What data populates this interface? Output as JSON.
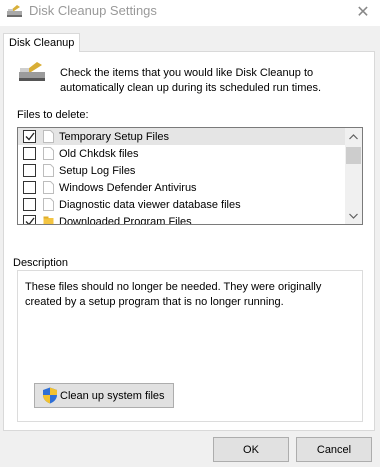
{
  "window": {
    "title": "Disk Cleanup Settings",
    "close_glyph": "✕",
    "title_icon": "disk-cleanup-icon"
  },
  "tab": {
    "label": "Disk Cleanup"
  },
  "intro": {
    "icon": "disk-cleanup-large-icon",
    "text": "Check the items that you would like Disk Cleanup to automatically clean up during its scheduled run times."
  },
  "files": {
    "label": "Files to delete:",
    "items": [
      {
        "label": "Temporary Setup Files",
        "checked": true,
        "icon": "file-icon",
        "selected": true
      },
      {
        "label": "Old Chkdsk files",
        "checked": false,
        "icon": "file-icon",
        "selected": false
      },
      {
        "label": "Setup Log Files",
        "checked": false,
        "icon": "file-icon",
        "selected": false
      },
      {
        "label": "Windows Defender Antivirus",
        "checked": false,
        "icon": "file-icon",
        "selected": false
      },
      {
        "label": "Diagnostic data viewer database files",
        "checked": false,
        "icon": "file-icon",
        "selected": false
      },
      {
        "label": "Downloaded Program Files",
        "checked": true,
        "icon": "folder-icon",
        "selected": false
      }
    ]
  },
  "description": {
    "legend": "Description",
    "text": "These files should no longer be needed. They were originally created by a setup program that is no longer running."
  },
  "buttons": {
    "cleanup_system": "Clean up system files",
    "ok": "OK",
    "cancel": "Cancel"
  },
  "colors": {
    "selection": "#e5e5e5",
    "button_bg": "#e1e1e1",
    "panel_bg": "#ffffff",
    "window_bg": "#f0f0f0"
  }
}
